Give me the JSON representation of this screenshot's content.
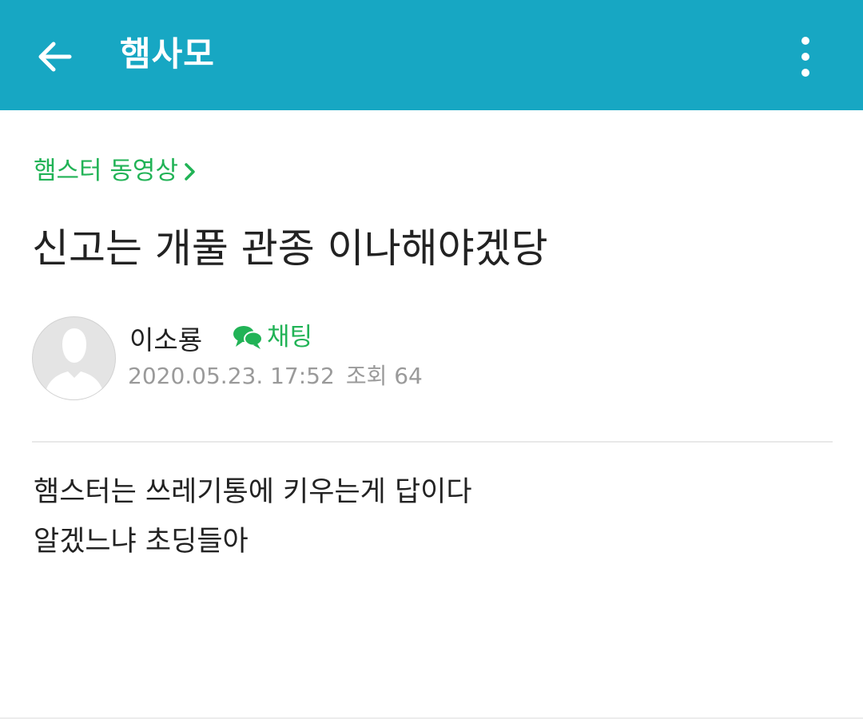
{
  "appbar": {
    "title": "햄사모",
    "back_icon": "arrow-left-icon",
    "menu_icon": "more-vertical-icon",
    "color": "#17a7c3"
  },
  "post": {
    "board": "햄스터 동영상",
    "title": "신고는 개풀 관종 이나해야겠당",
    "author": {
      "name": "이소룡",
      "chat_label": "채팅"
    },
    "date": "2020.05.23. 17:52",
    "views": "조회 64",
    "body": [
      "햄스터는 쓰레기통에 키우는게 답이다",
      "알겠느냐 초딩들아"
    ]
  },
  "colors": {
    "accent_green": "#21b356",
    "text_primary": "#222222",
    "text_meta": "#9a9a9a"
  }
}
